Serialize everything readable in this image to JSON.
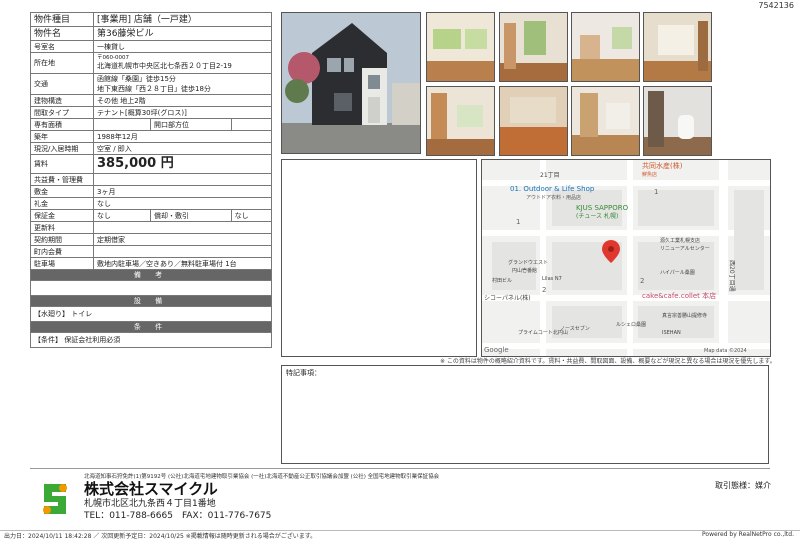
{
  "doc_id": "7542136",
  "property": {
    "type_label": "物件種目",
    "type_value": "[事業用] 店舗（一戸建）",
    "name_label": "物件名",
    "name_value": "第36藤栄ビル",
    "room_label": "号室名",
    "room_value": "一棟貸し",
    "address_label": "所在地",
    "postal": "〒060-0007",
    "address_value": "北海道札幌市中央区北七条西２０丁目2-19",
    "access_label": "交通",
    "access_line1": "函館線「桑園」徒歩15分",
    "access_line2": "地下東西線「西２８丁目」徒歩18分",
    "structure_label": "建物構造",
    "structure_value": "その他 地上2階",
    "layout_label": "間取タイプ",
    "layout_value": "テナント[概算30坪(グロス)]",
    "area_label": "専有面積",
    "opening_label": "開口部方位",
    "opening_value": "",
    "built_label": "築年",
    "built_value": "1988年12月",
    "status_label": "現況/入居時期",
    "status_value": "空室 / 即入",
    "rent_label": "賃料",
    "rent_value": "385,000 円",
    "fee_label": "共益費・管理費",
    "fee_value": "",
    "deposit_label": "敷金",
    "deposit_value": "3ヶ月",
    "keymoney_label": "礼金",
    "keymoney_value": "なし",
    "guarantee_label": "保証金",
    "guarantee_value": "なし",
    "amort_label": "償却・敷引",
    "amort_value": "なし",
    "renewal_label": "更新料",
    "renewal_value": "",
    "contract_label": "契約期間",
    "contract_value": "定期借家",
    "town_label": "町内会費",
    "town_value": "",
    "parking_label": "駐車場",
    "parking_value": "敷地内駐車場／空きあり／無料駐車場付 1台"
  },
  "sections": {
    "remarks_title": "備 考",
    "equipment_title": "設 備",
    "equipment_text": "【水廻り】 トイレ",
    "conditions_title": "条 件",
    "conditions_text": "【条件】 保証会社利用必須"
  },
  "map": {
    "labels": [
      "共同水産(株)",
      "鮮魚店",
      "01. Outdoor & Life Shop",
      "アウトドア衣料・用品店",
      "KJUS SAPPORO",
      "(チュース 札幌)",
      "21丁目",
      "1",
      "1",
      "2",
      "2",
      "グランドウエスト",
      "円山壱番館",
      "Lilas N7",
      "村田ビル",
      "源久工業札幌支店",
      "リニューアルセンター",
      "ハイパール桑園",
      "cake&cafe.collet 本店",
      "真言宗善勝山提修寺",
      "シコーパネル(株)",
      "ノースセブン",
      "プライムコート北円山",
      "ルシェロ桑園",
      "ISEHAN",
      "西20丁目通",
      "Google",
      "Map data ©2024"
    ]
  },
  "disclaimer": "※ この資料は物件の概略紹介資料です。賃料・共益費、間取図面、設備、概要などが現況と異なる場合は現況を優先します。",
  "remarks_label": "特記事項：",
  "footer": {
    "associations": "北海道知事石狩免許(1)第9192号 (公社)北海道宅地建物取引業協会 (一社)北海道不動産公正取引協議会加盟 (公社) 全国宅地建物取引業保証協会",
    "company": "株式会社スマイクル",
    "address": "札幌市北区北九条西４丁目1番地",
    "tel": "TEL：011-788-6665　FAX：011-776-7675",
    "mode": "取引態様：媒介",
    "printed": "出力日：2024/10/11 18:42:28 ／ 次回更新予定日：2024/10/25 ※掲載情報は随時更新される場合がございます。",
    "powered": "Powered by RealNetPro co.,ltd."
  },
  "colors": {
    "section_bg": "#666666",
    "pin": "#e0382f",
    "logo_green": "#3aa935",
    "logo_orange": "#f39800"
  }
}
